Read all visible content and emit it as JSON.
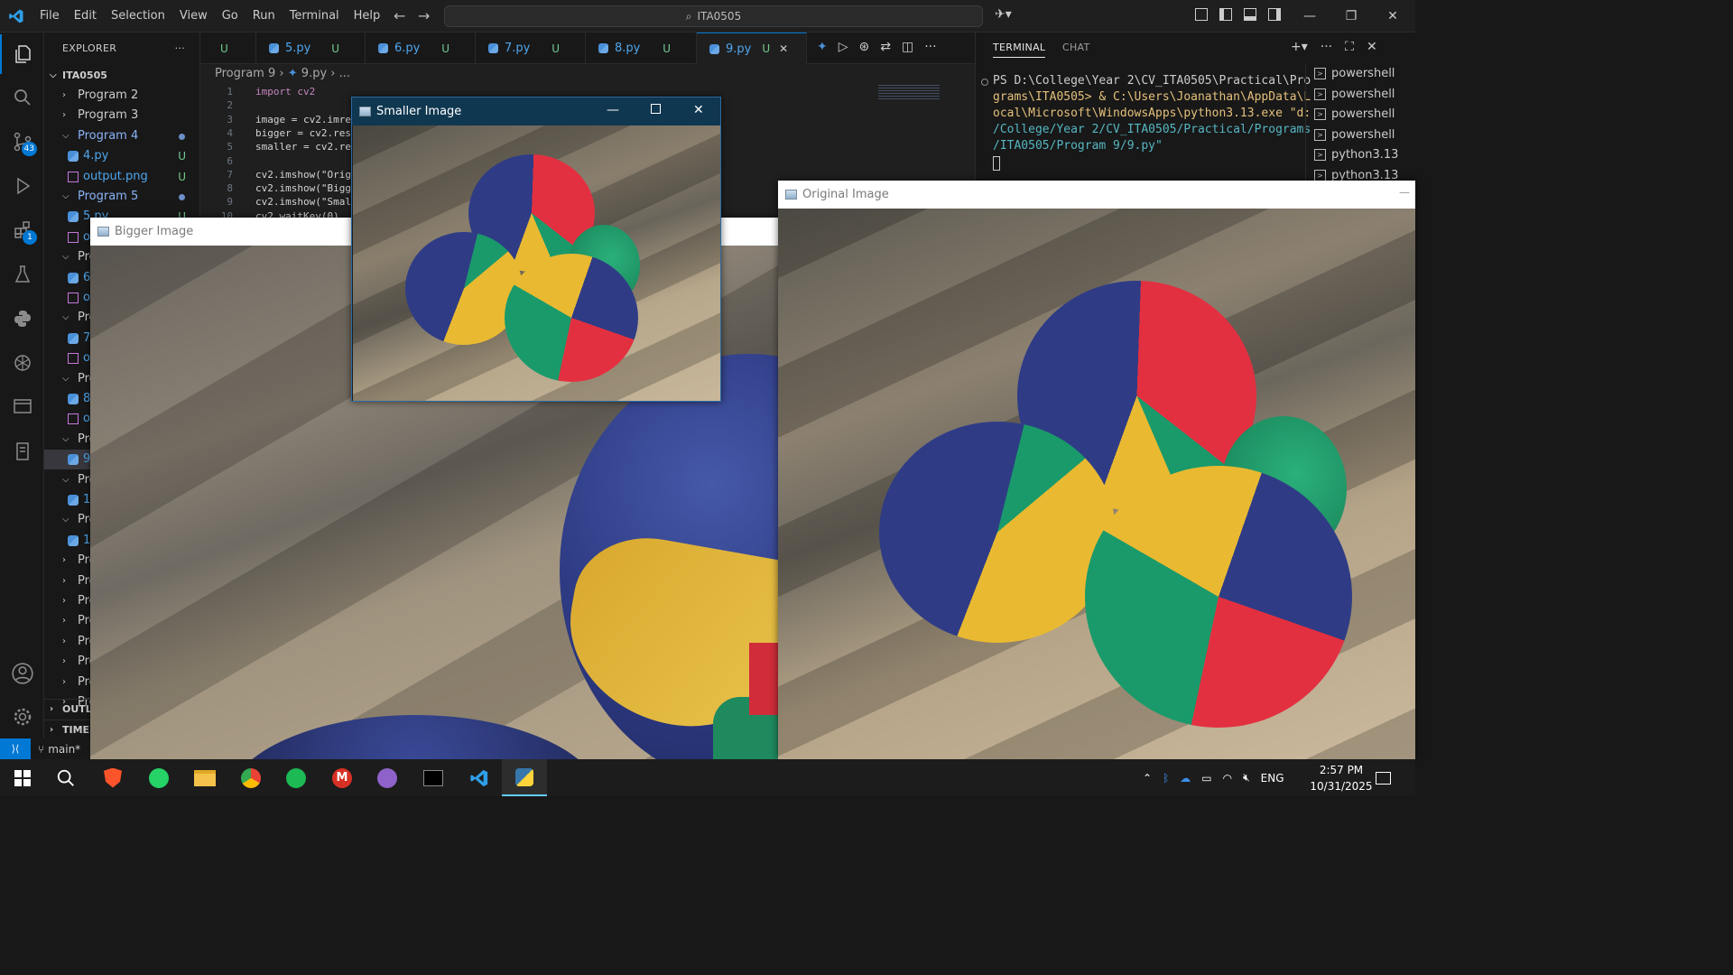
{
  "titlebar": {
    "menu": [
      "File",
      "Edit",
      "Selection",
      "View",
      "Go",
      "Run",
      "Terminal",
      "Help"
    ],
    "search": "ITA0505"
  },
  "activity_badges": {
    "source_control": "43",
    "extensions": "1"
  },
  "explorer": {
    "header": "EXPLORER",
    "root": "ITA0505",
    "rows": [
      {
        "label": "Program 2",
        "kind": "folder-closed",
        "depth": 1
      },
      {
        "label": "Program 3",
        "kind": "folder-closed",
        "depth": 1
      },
      {
        "label": "Program 4",
        "kind": "folder-open",
        "depth": 1,
        "dot": true
      },
      {
        "label": "4.py",
        "kind": "py",
        "depth": 2,
        "status": "U"
      },
      {
        "label": "output.png",
        "kind": "img",
        "depth": 2,
        "status": "U"
      },
      {
        "label": "Program 5",
        "kind": "folder-open",
        "depth": 1,
        "dot": true
      },
      {
        "label": "5.py",
        "kind": "py",
        "depth": 2,
        "status": "U"
      },
      {
        "label": "o",
        "kind": "img",
        "depth": 2
      },
      {
        "label": "Pro",
        "kind": "folder-open",
        "depth": 1
      },
      {
        "label": "6.",
        "kind": "py",
        "depth": 2
      },
      {
        "label": "o",
        "kind": "img",
        "depth": 2
      },
      {
        "label": "Pro",
        "kind": "folder-open",
        "depth": 1
      },
      {
        "label": "7.",
        "kind": "py",
        "depth": 2
      },
      {
        "label": "o",
        "kind": "img",
        "depth": 2
      },
      {
        "label": "Pro",
        "kind": "folder-open",
        "depth": 1
      },
      {
        "label": "8.",
        "kind": "py",
        "depth": 2
      },
      {
        "label": "o",
        "kind": "img",
        "depth": 2
      },
      {
        "label": "Pro",
        "kind": "folder-open",
        "depth": 1
      },
      {
        "label": "9.",
        "kind": "py",
        "depth": 2,
        "selected": true
      },
      {
        "label": "Pro",
        "kind": "folder-open",
        "depth": 1
      },
      {
        "label": "1(",
        "kind": "py",
        "depth": 2
      },
      {
        "label": "Pro",
        "kind": "folder-open",
        "depth": 1
      },
      {
        "label": "1",
        "kind": "py",
        "depth": 2
      },
      {
        "label": "Pro",
        "kind": "folder-closed",
        "depth": 1
      },
      {
        "label": "Pro",
        "kind": "folder-closed",
        "depth": 1
      },
      {
        "label": "Pro",
        "kind": "folder-closed",
        "depth": 1
      },
      {
        "label": "Pro",
        "kind": "folder-closed",
        "depth": 1
      },
      {
        "label": "Pro",
        "kind": "folder-closed",
        "depth": 1
      },
      {
        "label": "Pro",
        "kind": "folder-closed",
        "depth": 1
      },
      {
        "label": "Pro",
        "kind": "folder-closed",
        "depth": 1
      },
      {
        "label": "Pro",
        "kind": "folder-closed",
        "depth": 1
      }
    ],
    "outline": "OUTLI",
    "timeline": "TIMEL"
  },
  "tabs": [
    {
      "label": "",
      "status": "U"
    },
    {
      "label": "5.py",
      "status": "U"
    },
    {
      "label": "6.py",
      "status": "U"
    },
    {
      "label": "7.py",
      "status": "U"
    },
    {
      "label": "8.py",
      "status": "U"
    },
    {
      "label": "9.py",
      "status": "U",
      "active": true
    }
  ],
  "breadcrumb": {
    "folder": "Program 9",
    "file": "9.py",
    "more": "..."
  },
  "code": [
    {
      "n": "1",
      "text": "import cv2"
    },
    {
      "n": "2",
      "text": ""
    },
    {
      "n": "3",
      "text": "image = cv2.imrea"
    },
    {
      "n": "4",
      "text": "bigger = cv2.resi"
    },
    {
      "n": "5",
      "text": "smaller = cv2.res"
    },
    {
      "n": "6",
      "text": ""
    },
    {
      "n": "7",
      "text": "cv2.imshow(\"Origi"
    },
    {
      "n": "8",
      "text": "cv2.imshow(\"Bigge"
    },
    {
      "n": "9",
      "text": "cv2.imshow(\"Small"
    },
    {
      "n": "10",
      "text": "cv2.waitKey(0)"
    }
  ],
  "panel": {
    "tabs": [
      "TERMINAL",
      "CHAT"
    ],
    "lines": [
      "PS D:\\College\\Year 2\\CV_ITA0505\\Practical\\Pro",
      "grams\\ITA0505> & C:\\Users\\Joanathan\\AppData\\L",
      "ocal\\Microsoft\\WindowsApps\\python3.13.exe \"d:",
      "/College/Year 2/CV_ITA0505/Practical/Programs",
      "/ITA0505/Program 9/9.py\""
    ],
    "sessions": [
      "powershell",
      "powershell",
      "powershell",
      "powershell",
      "python3.13",
      "python3.13"
    ]
  },
  "windows": {
    "smaller": "Smaller Image",
    "bigger": "Bigger Image",
    "original": "Original Image"
  },
  "statusbar": {
    "branch": "main*"
  },
  "taskbar": {
    "apps": [
      "start",
      "search",
      "brave",
      "whatsapp",
      "file-explorer",
      "chrome",
      "spotify",
      "gmail",
      "github",
      "terminal",
      "vscode",
      "python"
    ],
    "lang": "ENG",
    "time": "2:57 PM",
    "date": "10/31/2025"
  },
  "colors": {
    "accent": "#0078d4",
    "untracked": "#73c991",
    "ball_red": "#e23040",
    "ball_blue": "#33428f",
    "ball_yellow": "#e9b932",
    "ball_green": "#1a9a6a"
  }
}
